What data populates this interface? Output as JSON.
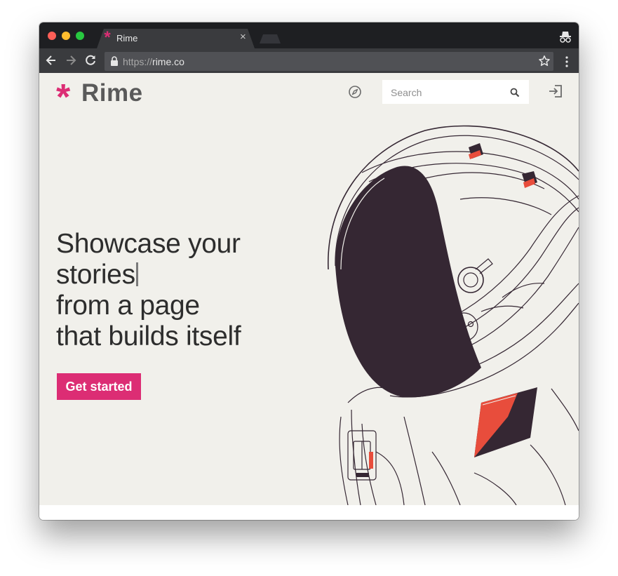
{
  "browser": {
    "tab": {
      "title": "Rime",
      "close_glyph": "×",
      "favicon": "asterisk-icon"
    },
    "address_bar": {
      "protocol": "https://",
      "host": "rime.co"
    },
    "colors": {
      "chrome": "#1e1f22",
      "toolbar": "#3a3b3e",
      "close": "#fd5f57",
      "minimize": "#febc2e",
      "zoom": "#28c840"
    }
  },
  "site": {
    "logo": {
      "mark": "*",
      "word": "Rime"
    },
    "search": {
      "placeholder": "Search"
    },
    "hero": {
      "line1": "Showcase your",
      "line2": "stories",
      "line3": "from a page",
      "line4": "that builds itself"
    },
    "cta": {
      "label": "Get started"
    },
    "colors": {
      "accent": "#dc2d74",
      "background": "#f1f0eb",
      "visor": "#352733",
      "patch_red": "#e84d3c"
    }
  }
}
